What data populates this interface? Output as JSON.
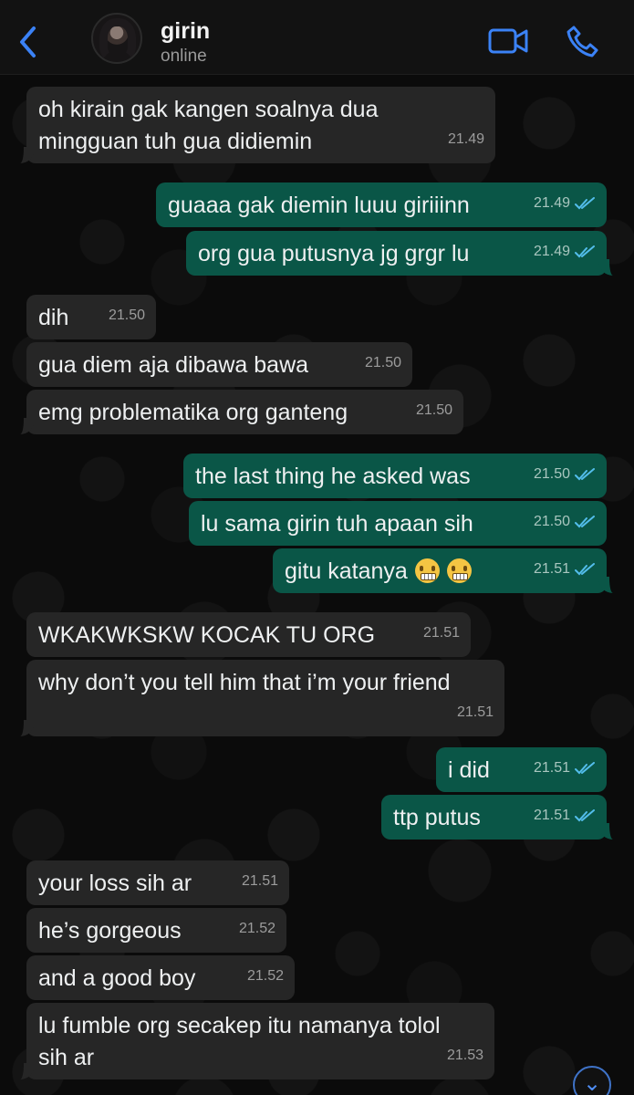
{
  "header": {
    "contact_name": "girin",
    "contact_status": "online",
    "icons": [
      "back-chevron-icon",
      "video-call-icon",
      "phone-call-icon"
    ],
    "accent_color": "#2f80ed"
  },
  "messages": [
    {
      "direction": "incoming",
      "text": "oh kirain gak kangen soalnya dua\nmingguan tuh gua didiemin",
      "time": "21.49"
    },
    {
      "direction": "outgoing",
      "text": "guaaa gak diemin luuu giriiinn",
      "time": "21.49",
      "read": true
    },
    {
      "direction": "outgoing",
      "text": "org gua putusnya jg grgr lu",
      "time": "21.49",
      "read": true
    },
    {
      "direction": "incoming",
      "text": "dih",
      "time": "21.50"
    },
    {
      "direction": "incoming",
      "text": "gua diem aja dibawa bawa",
      "time": "21.50"
    },
    {
      "direction": "incoming",
      "text": "emg problematika org ganteng",
      "time": "21.50"
    },
    {
      "direction": "outgoing",
      "text": "the last thing he asked was",
      "time": "21.50",
      "read": true
    },
    {
      "direction": "outgoing",
      "text": "lu sama girin tuh apaan sih",
      "time": "21.50",
      "read": true
    },
    {
      "direction": "outgoing",
      "text": "gitu katanya",
      "time": "21.51",
      "read": true,
      "emoji": [
        "grimacing-face-emoji",
        "grimacing-face-emoji"
      ]
    },
    {
      "direction": "incoming",
      "text": "WKAKWKSKW KOCAK TU ORG",
      "time": "21.51"
    },
    {
      "direction": "incoming",
      "text": "why don’t you tell him that i’m your friend",
      "time": "21.51"
    },
    {
      "direction": "outgoing",
      "text": "i did",
      "time": "21.51",
      "read": true
    },
    {
      "direction": "outgoing",
      "text": "ttp putus",
      "time": "21.51",
      "read": true
    },
    {
      "direction": "incoming",
      "text": "your loss sih ar",
      "time": "21.51"
    },
    {
      "direction": "incoming",
      "text": "he’s gorgeous",
      "time": "21.52"
    },
    {
      "direction": "incoming",
      "text": "and a good boy",
      "time": "21.52"
    },
    {
      "direction": "incoming",
      "text": "lu fumble org secakep itu namanya tolol\nsih ar",
      "time": "21.53"
    }
  ],
  "theme": {
    "incoming_bubble": "#262626",
    "outgoing_bubble": "#0a5647",
    "read_tick": "#53bdeb"
  }
}
